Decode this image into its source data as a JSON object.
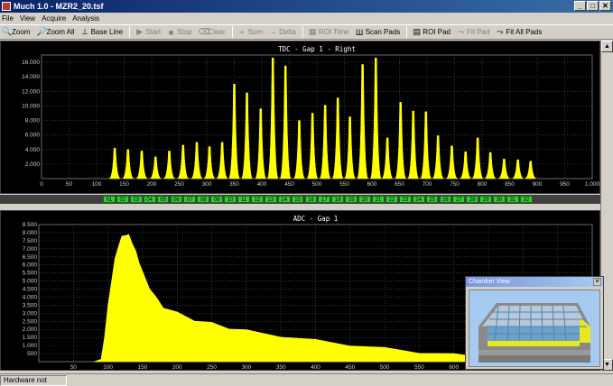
{
  "window": {
    "title": "Much 1.0 - MZR2_20.tsf",
    "minimize": "_",
    "maximize": "□",
    "close": "✕"
  },
  "menu": [
    "File",
    "View",
    "Acquire",
    "Analysis"
  ],
  "toolbar": [
    {
      "label": "Zoom",
      "icon": "magnifier-icon",
      "glyph": "🔍",
      "enabled": true
    },
    {
      "label": "Zoom All",
      "icon": "magnifier-all-icon",
      "glyph": "🔎",
      "enabled": true
    },
    {
      "label": "Base Line",
      "icon": "baseline-icon",
      "glyph": "⊥",
      "enabled": true
    },
    {
      "label": "Start",
      "icon": "play-icon",
      "glyph": "▶",
      "enabled": false
    },
    {
      "label": "Stop",
      "icon": "stop-icon",
      "glyph": "■",
      "enabled": false
    },
    {
      "label": "Clear",
      "icon": "clear-icon",
      "glyph": "⌫",
      "enabled": false
    },
    {
      "label": "Sum",
      "icon": "plus-icon",
      "glyph": "+",
      "enabled": false
    },
    {
      "label": "Delta",
      "icon": "minus-icon",
      "glyph": "−",
      "enabled": false
    },
    {
      "label": "ROI Time",
      "icon": "roi-time-icon",
      "glyph": "▦",
      "enabled": false
    },
    {
      "label": "Scan Pads",
      "icon": "scan-pads-icon",
      "glyph": "Ш",
      "enabled": true
    },
    {
      "label": "ROI Pad",
      "icon": "roi-pad-icon",
      "glyph": "▤",
      "enabled": true
    },
    {
      "label": "Fit Pad",
      "icon": "fit-pad-icon",
      "glyph": "⤳",
      "enabled": false
    },
    {
      "label": "Fit All Pads",
      "icon": "fit-all-pads-icon",
      "glyph": "⤳",
      "enabled": true
    }
  ],
  "colors": {
    "trace": "#ffff00",
    "plot_bg": "#000000",
    "grid": "#555555",
    "axis_text": "#cccccc",
    "pad_on": "#33cc33"
  },
  "pads": [
    "01",
    "02",
    "03",
    "04",
    "05",
    "06",
    "07",
    "08",
    "09",
    "10",
    "11",
    "12",
    "13",
    "14",
    "15",
    "16",
    "17",
    "18",
    "19",
    "20",
    "21",
    "22",
    "23",
    "24",
    "25",
    "26",
    "27",
    "28",
    "29",
    "30",
    "31",
    "32"
  ],
  "chart_data": [
    {
      "type": "bar",
      "title": "TDC - Gap 1 - Right",
      "xlim": [
        0,
        1000
      ],
      "ylim": [
        0,
        17000
      ],
      "xticks": [
        0,
        50,
        100,
        150,
        200,
        250,
        300,
        350,
        400,
        450,
        500,
        550,
        600,
        650,
        700,
        750,
        800,
        850,
        900,
        950,
        1000
      ],
      "xtick_labels": [
        "0",
        "50",
        "100",
        "150",
        "200",
        "250",
        "300",
        "350",
        "400",
        "450",
        "500",
        "550",
        "600",
        "650",
        "700",
        "750",
        "800",
        "850",
        "900",
        "950",
        "1.000"
      ],
      "yticks": [
        2000,
        4000,
        6000,
        8000,
        10000,
        12000,
        14000,
        16000
      ],
      "ytick_labels": [
        "2.000",
        "4.000",
        "6.000",
        "8.000",
        "10.000",
        "12.000",
        "14.000",
        "16.000"
      ],
      "grid": true,
      "peaks": {
        "x": [
          133,
          157,
          182,
          207,
          232,
          257,
          282,
          305,
          328,
          350,
          373,
          398,
          420,
          443,
          468,
          492,
          515,
          538,
          560,
          583,
          607,
          628,
          652,
          675,
          698,
          720,
          745,
          770,
          792,
          815,
          840,
          865,
          888
        ],
        "y": [
          4200,
          4000,
          3800,
          3000,
          3800,
          4600,
          5000,
          4400,
          5000,
          13000,
          11800,
          9600,
          16600,
          15500,
          8000,
          9000,
          10100,
          11100,
          8500,
          15700,
          16600,
          5600,
          10500,
          9300,
          9200,
          5900,
          4500,
          3700,
          5600,
          3600,
          2700,
          2600,
          2400
        ]
      }
    },
    {
      "type": "area",
      "title": "ADC - Gap 1",
      "xlim": [
        0,
        800
      ],
      "ylim": [
        0,
        8500
      ],
      "xticks": [
        50,
        100,
        150,
        200,
        250,
        300,
        350,
        400,
        450,
        500,
        550,
        600,
        650,
        700,
        750
      ],
      "xtick_labels": [
        "50",
        "100",
        "150",
        "200",
        "250",
        "300",
        "350",
        "400",
        "450",
        "500",
        "550",
        "600",
        "650",
        "700",
        "750"
      ],
      "yticks": [
        500,
        1000,
        1500,
        2000,
        2500,
        3000,
        3500,
        4000,
        4500,
        5000,
        5500,
        6000,
        6500,
        7000,
        7500,
        8000,
        8500
      ],
      "ytick_labels": [
        "500",
        "1.000",
        "1.500",
        "2.000",
        "2.500",
        "3.000",
        "3.500",
        "4.000",
        "4.500",
        "5.000",
        "5.500",
        "6.000",
        "6.500",
        "7.000",
        "7.500",
        "8.000",
        "8.500"
      ],
      "grid": true,
      "x": [
        80,
        90,
        95,
        100,
        105,
        110,
        115,
        120,
        125,
        130,
        135,
        140,
        145,
        150,
        160,
        170,
        180,
        200,
        225,
        250,
        275,
        300,
        350,
        400,
        450,
        500,
        550,
        600,
        650,
        700,
        750,
        780
      ],
      "y": [
        0,
        150,
        1500,
        3500,
        5000,
        6300,
        7200,
        7700,
        7900,
        7800,
        7400,
        6800,
        6200,
        5500,
        4600,
        3900,
        3400,
        3000,
        2600,
        2350,
        2100,
        1900,
        1600,
        1300,
        1050,
        800,
        600,
        420,
        280,
        160,
        70,
        20
      ]
    }
  ],
  "chamber_view": {
    "title": "Chamber View",
    "close": "✕"
  },
  "status": "Hardware not found"
}
